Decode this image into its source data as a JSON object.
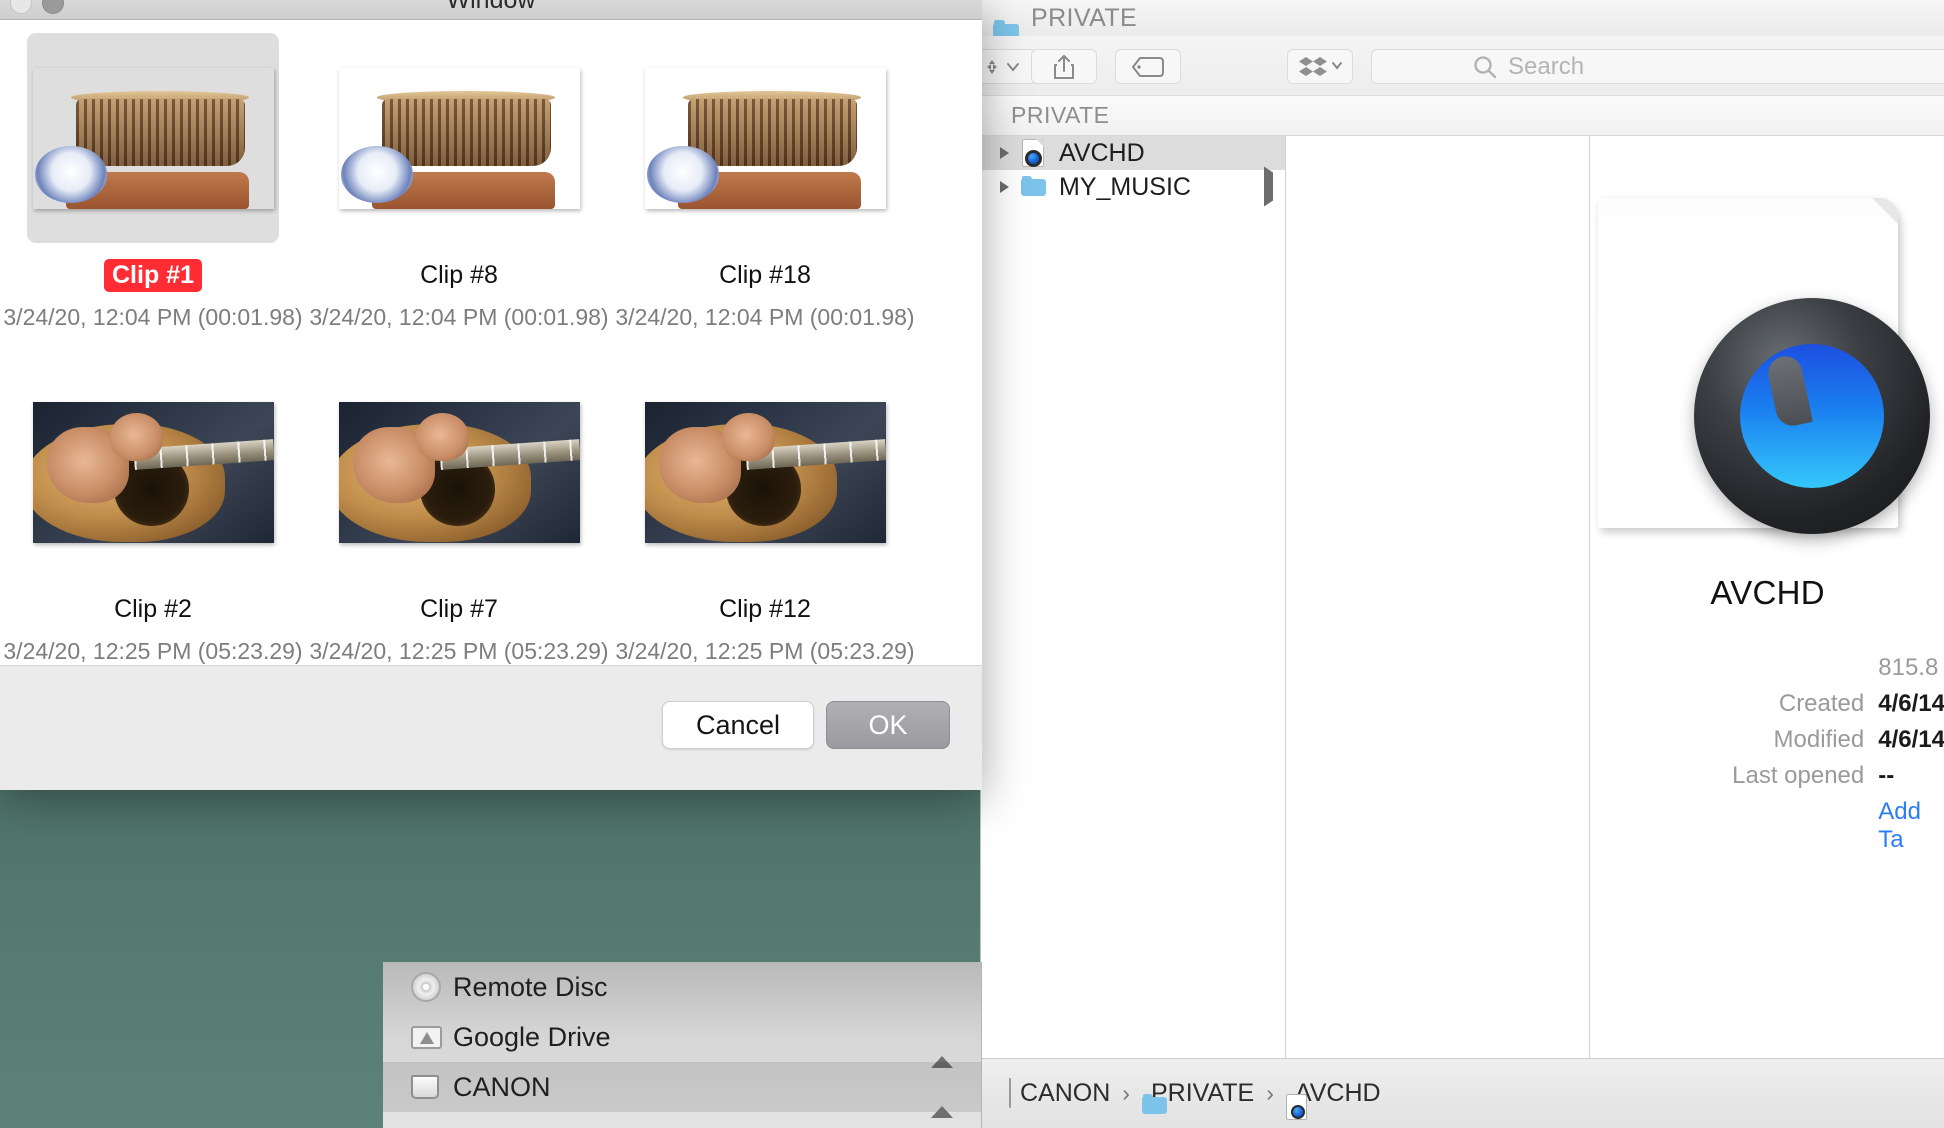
{
  "desktop": {
    "wallpaper_color": "#4b6f66"
  },
  "modal": {
    "title": "Window",
    "selected_clip_accent": "#ff2d33",
    "clips": [
      {
        "name": "Clip #1",
        "timestamp": "3/24/20, 12:04 PM (00:01.98)",
        "thumb": "basket",
        "selected": true
      },
      {
        "name": "Clip #8",
        "timestamp": "3/24/20, 12:04 PM (00:01.98)",
        "thumb": "basket",
        "selected": false
      },
      {
        "name": "Clip #18",
        "timestamp": "3/24/20, 12:04 PM (00:01.98)",
        "thumb": "basket",
        "selected": false
      },
      {
        "name": "Clip #2",
        "timestamp": "3/24/20, 12:25 PM (05:23.29)",
        "thumb": "guitar",
        "selected": false
      },
      {
        "name": "Clip #7",
        "timestamp": "3/24/20, 12:25 PM (05:23.29)",
        "thumb": "guitar",
        "selected": false
      },
      {
        "name": "Clip #12",
        "timestamp": "3/24/20, 12:25 PM (05:23.29)",
        "thumb": "guitar",
        "selected": false
      }
    ],
    "buttons": {
      "cancel": "Cancel",
      "ok": "OK"
    }
  },
  "finder": {
    "window_title": "PRIVATE",
    "toolbar": {
      "arrange_icon": "arrange-icon",
      "share_icon": "share-icon",
      "tag_icon": "tag-icon",
      "dropbox_icon": "dropbox-icon",
      "search_icon": "search-icon",
      "search_placeholder": "Search",
      "search_value": ""
    },
    "column_header": "PRIVATE",
    "items": [
      {
        "label": "AVCHD",
        "icon": "quicktime-document-icon",
        "selected": true,
        "has_disclosure": true,
        "has_right_arrow": false
      },
      {
        "label": "MY_MUSIC",
        "icon": "folder-icon",
        "selected": false,
        "has_disclosure": true,
        "has_right_arrow": true
      }
    ],
    "preview": {
      "icon": "quicktime-document-icon",
      "name": "AVCHD",
      "meta": [
        {
          "label": "",
          "value": "815.8",
          "style": "size"
        },
        {
          "label": "Created",
          "value": "4/6/14",
          "style": "bold"
        },
        {
          "label": "Modified",
          "value": "4/6/14",
          "style": "bold"
        },
        {
          "label": "Last opened",
          "value": "--",
          "style": "bold"
        }
      ],
      "add_tags_link": "Add Ta"
    },
    "sidebar": [
      {
        "label": "Remote Disc",
        "icon": "disc-icon",
        "eject": false,
        "selected": false
      },
      {
        "label": "Google Drive",
        "icon": "gdrive-icon",
        "eject": true,
        "selected": false
      },
      {
        "label": "CANON",
        "icon": "drive-icon",
        "eject": true,
        "selected": true
      }
    ],
    "pathbar": [
      {
        "label": "CANON",
        "icon": "drive-icon"
      },
      {
        "label": "PRIVATE",
        "icon": "folder-icon"
      },
      {
        "label": "AVCHD",
        "icon": "quicktime-document-icon"
      }
    ],
    "pathbar_separator": "›"
  }
}
